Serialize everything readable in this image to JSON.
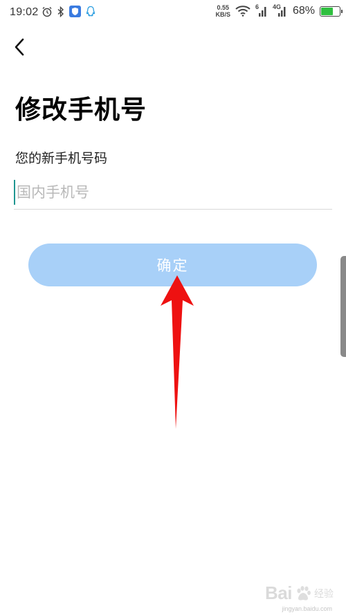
{
  "status_bar": {
    "time": "19:02",
    "net_speed_value": "0.55",
    "net_speed_unit": "KB/S",
    "signal_1_label": "6",
    "signal_2_label": "4G",
    "battery_percent_text": "68%",
    "battery_level": 0.68,
    "icons": [
      "alarm-icon",
      "bluetooth-icon",
      "shield-app-icon",
      "qq-icon",
      "wifi-icon",
      "signal-icon",
      "battery-icon"
    ]
  },
  "header": {
    "back_icon": "chevron-left-icon"
  },
  "page": {
    "title": "修改手机号",
    "field_label": "您的新手机号码",
    "phone_input": {
      "value": "",
      "placeholder": "国内手机号"
    },
    "confirm_label": "确定"
  },
  "colors": {
    "accent_cursor": "#1e9690",
    "button_disabled": "#a8d0f8",
    "annotation_arrow": "#ee1111"
  },
  "watermark": {
    "brand": "Bai",
    "brand_suffix": "经验",
    "domain": "jingyan.baidu.com"
  }
}
